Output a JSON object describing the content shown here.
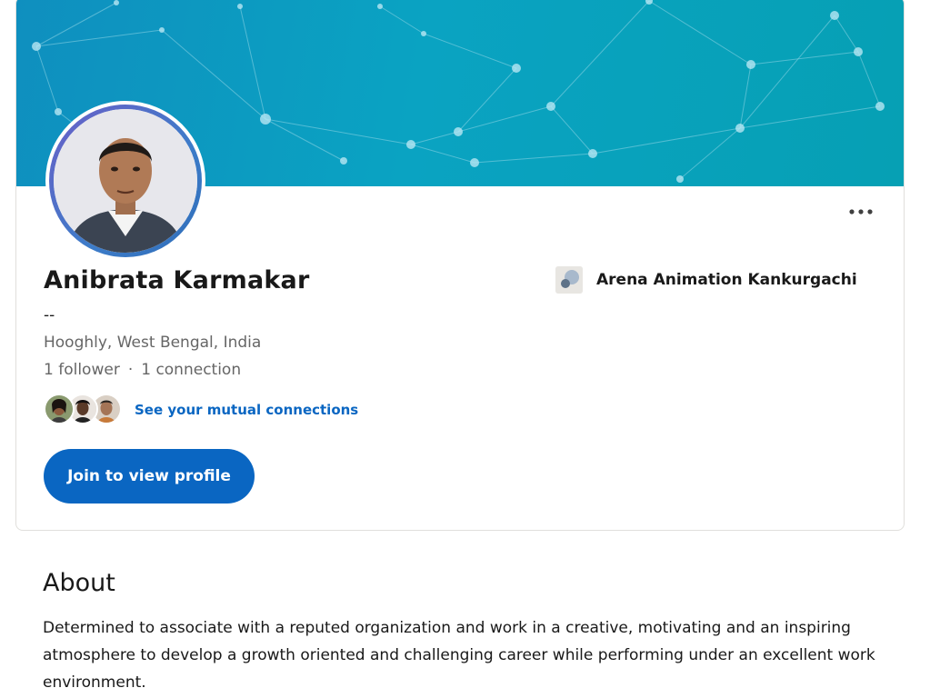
{
  "profile": {
    "name": "Anibrata Karmakar",
    "headline": "--",
    "location": "Hooghly, West Bengal, India",
    "followers": "1 follower",
    "separator": "·",
    "connections": "1 connection",
    "mutual_link": "See your mutual connections",
    "join_button": "Join to view profile",
    "more_menu_icon": "ellipsis-icon",
    "avatar_icon": "profile-photo",
    "company": {
      "name": "Arena Animation Kankurgachi",
      "logo_icon": "company-logo-icon"
    }
  },
  "about": {
    "title": "About",
    "text": "Determined to associate with a reputed organization and work in a creative, motivating and an inspiring atmosphere to develop a growth oriented and challenging career while performing under an excellent work environment."
  },
  "colors": {
    "primary": "#0a66c2",
    "banner_start": "#0f8fbf",
    "banner_end": "#06a0b4",
    "text": "#191919",
    "secondary_text": "#666666"
  }
}
